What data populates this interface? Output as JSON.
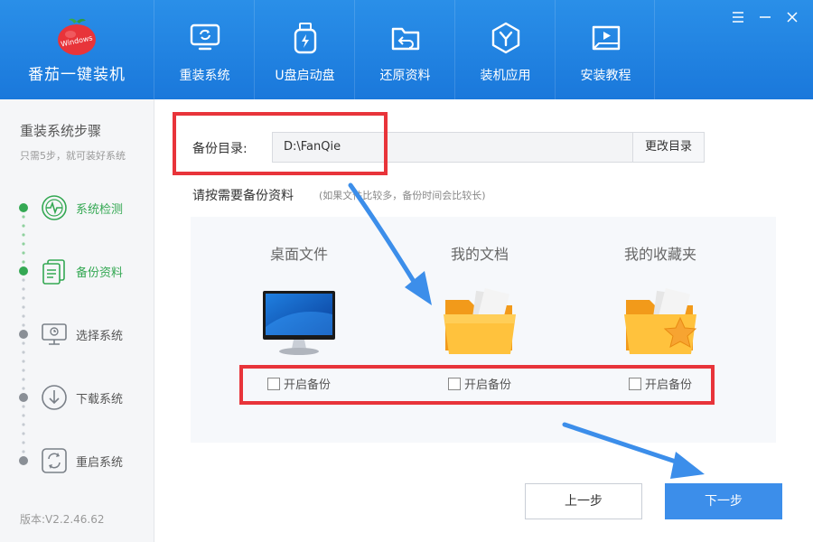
{
  "app": {
    "title": "番茄一键装机",
    "logo_text": "Windows"
  },
  "nav": [
    {
      "label": "重装系统",
      "icon": "monitor-refresh-icon"
    },
    {
      "label": "U盘启动盘",
      "icon": "usb-drive-icon"
    },
    {
      "label": "还原资料",
      "icon": "folder-restore-icon"
    },
    {
      "label": "装机应用",
      "icon": "app-hexagon-icon"
    },
    {
      "label": "安装教程",
      "icon": "video-book-icon"
    }
  ],
  "sidebar": {
    "title": "重装系统步骤",
    "subtitle": "只需5步，就可装好系统",
    "steps": [
      {
        "label": "系统检测",
        "icon": "system-check-icon",
        "state": "done"
      },
      {
        "label": "备份资料",
        "icon": "backup-docs-icon",
        "state": "active"
      },
      {
        "label": "选择系统",
        "icon": "select-system-icon",
        "state": "pending"
      },
      {
        "label": "下载系统",
        "icon": "download-icon",
        "state": "pending"
      },
      {
        "label": "重启系统",
        "icon": "restart-icon",
        "state": "pending"
      }
    ],
    "version": "版本:V2.2.46.62"
  },
  "main": {
    "backup_dir_label": "备份目录:",
    "backup_dir_value": "D:\\FanQie",
    "change_dir_button": "更改目录",
    "select_title": "请按需要备份资料",
    "select_hint": "(如果文件比较多，备份时间会比较长)",
    "cards": [
      {
        "title": "桌面文件",
        "checkbox_label": "开启备份",
        "icon": "desktop-monitor-icon"
      },
      {
        "title": "我的文档",
        "checkbox_label": "开启备份",
        "icon": "documents-folder-icon"
      },
      {
        "title": "我的收藏夹",
        "checkbox_label": "开启备份",
        "icon": "favorites-folder-icon"
      }
    ],
    "prev_button": "上一步",
    "next_button": "下一步"
  },
  "colors": {
    "header": "#1a78db",
    "accent": "#3c8eea",
    "active_step": "#34a853",
    "highlight": "#e8343a",
    "folder": "#f9a825"
  }
}
